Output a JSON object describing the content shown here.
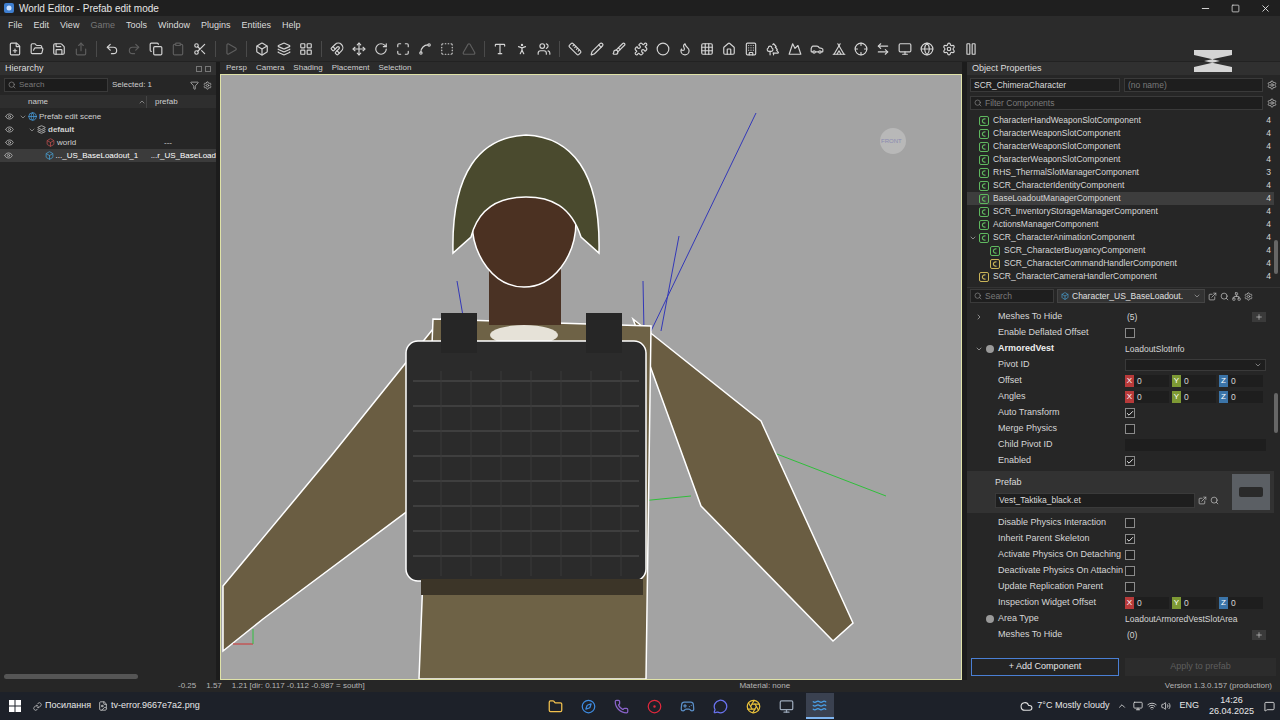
{
  "window": {
    "title": "World Editor - Prefab edit mode"
  },
  "menu": [
    {
      "label": "File",
      "disabled": false
    },
    {
      "label": "Edit",
      "disabled": false
    },
    {
      "label": "View",
      "disabled": false
    },
    {
      "label": "Game",
      "disabled": true
    },
    {
      "label": "Tools",
      "disabled": false
    },
    {
      "label": "Window",
      "disabled": false
    },
    {
      "label": "Plugins",
      "disabled": false
    },
    {
      "label": "Entities",
      "disabled": false
    },
    {
      "label": "Help",
      "disabled": false
    }
  ],
  "toolbar": [
    {
      "kind": "button",
      "disabled": false
    },
    {
      "kind": "button",
      "disabled": false
    },
    {
      "kind": "button",
      "disabled": false
    },
    {
      "kind": "button",
      "disabled": true
    },
    {
      "kind": "separator"
    },
    {
      "kind": "button",
      "disabled": false
    },
    {
      "kind": "button",
      "disabled": true
    },
    {
      "kind": "button",
      "disabled": false
    },
    {
      "kind": "button",
      "disabled": true
    },
    {
      "kind": "button",
      "disabled": false
    },
    {
      "kind": "separator"
    },
    {
      "kind": "button",
      "disabled": true
    },
    {
      "kind": "separator"
    },
    {
      "kind": "button",
      "disabled": false
    },
    {
      "kind": "button",
      "disabled": false
    },
    {
      "kind": "button",
      "disabled": false
    },
    {
      "kind": "separator"
    },
    {
      "kind": "button",
      "disabled": false
    },
    {
      "kind": "button",
      "disabled": false
    },
    {
      "kind": "button",
      "disabled": false
    },
    {
      "kind": "button",
      "disabled": false
    },
    {
      "kind": "button",
      "disabled": false
    },
    {
      "kind": "button",
      "disabled": false
    },
    {
      "kind": "button",
      "disabled": true
    },
    {
      "kind": "separator"
    },
    {
      "kind": "button",
      "disabled": false
    },
    {
      "kind": "button",
      "disabled": false
    },
    {
      "kind": "button",
      "disabled": false
    },
    {
      "kind": "separator"
    },
    {
      "kind": "button",
      "disabled": false
    },
    {
      "kind": "button",
      "disabled": false
    },
    {
      "kind": "button",
      "disabled": false
    },
    {
      "kind": "button",
      "disabled": false
    },
    {
      "kind": "button",
      "disabled": false
    },
    {
      "kind": "button",
      "disabled": false
    },
    {
      "kind": "button",
      "disabled": false
    },
    {
      "kind": "button",
      "disabled": false
    },
    {
      "kind": "button",
      "disabled": false
    },
    {
      "kind": "button",
      "disabled": false
    },
    {
      "kind": "button",
      "disabled": false
    },
    {
      "kind": "button",
      "disabled": false
    },
    {
      "kind": "button",
      "disabled": false
    },
    {
      "kind": "button",
      "disabled": false
    },
    {
      "kind": "button",
      "disabled": false
    },
    {
      "kind": "button",
      "disabled": false
    },
    {
      "kind": "button",
      "disabled": false
    },
    {
      "kind": "button",
      "disabled": false
    },
    {
      "kind": "button",
      "disabled": false
    }
  ],
  "hierarchy": {
    "title": "Hierarchy",
    "search_placeholder": "Search",
    "selected_count": "Selected: 1",
    "columns": [
      "name",
      "prefab"
    ],
    "tree": [
      {
        "name": "Prefab edit scene",
        "prefab": "",
        "kind": "scene",
        "visible": true,
        "selected": false,
        "expanded": true,
        "children": [
          {
            "name": "default",
            "prefab": "",
            "kind": "layer",
            "visible": true,
            "selected": false,
            "expanded": true,
            "children": [
              {
                "name": "world",
                "prefab": "---",
                "kind": "world",
                "visible": true,
                "selected": false
              },
              {
                "name": "..._US_BaseLoadout_1",
                "prefab": "...r_US_BaseLoad",
                "kind": "entity",
                "visible": true,
                "selected": true
              }
            ]
          }
        ]
      }
    ]
  },
  "viewport": {
    "tabs": [
      "Persp",
      "Camera",
      "Shading",
      "Placement",
      "Selection"
    ],
    "gizmo_label": "FRONT"
  },
  "properties": {
    "title": "Object Properties",
    "class_name": "SCR_ChimeraCharacter",
    "entity_name": "(no name)",
    "filter_placeholder": "Filter Components",
    "components": [
      {
        "name": "CharacterHandWeaponSlotComponent",
        "count": "4",
        "selected": false,
        "color": "#5fb85f"
      },
      {
        "name": "CharacterWeaponSlotComponent",
        "count": "4",
        "selected": false,
        "color": "#5fb85f"
      },
      {
        "name": "CharacterWeaponSlotComponent",
        "count": "4",
        "selected": false,
        "color": "#5fb85f"
      },
      {
        "name": "CharacterWeaponSlotComponent",
        "count": "4",
        "selected": false,
        "color": "#5fb85f"
      },
      {
        "name": "RHS_ThermalSlotManagerComponent",
        "count": "3",
        "selected": false,
        "color": "#5fb85f"
      },
      {
        "name": "SCR_CharacterIdentityComponent",
        "count": "4",
        "selected": false,
        "color": "#5fb85f"
      },
      {
        "name": "BaseLoadoutManagerComponent",
        "count": "4",
        "selected": true,
        "color": "#5fb85f"
      },
      {
        "name": "SCR_InventoryStorageManagerComponent",
        "count": "4",
        "selected": false,
        "color": "#5fb85f"
      },
      {
        "name": "ActionsManagerComponent",
        "count": "4",
        "selected": false,
        "color": "#5fb85f"
      },
      {
        "name": "SCR_CharacterAnimationComponent",
        "count": "4",
        "selected": false,
        "color": "#5fb85f",
        "expanded": true,
        "children": [
          {
            "name": "SCR_CharacterBuoyancyComponent",
            "count": "4",
            "selected": false,
            "color": "#5fb85f"
          },
          {
            "name": "SCR_CharacterCommandHandlerComponent",
            "count": "4",
            "selected": false,
            "color": "#c9b458"
          }
        ]
      },
      {
        "name": "SCR_CharacterCameraHandlerComponent",
        "count": "4",
        "selected": false,
        "color": "#c9b458"
      }
    ],
    "search_placeholder": "Search",
    "prefab_name": "Character_US_BaseLoadout.",
    "fields": [
      {
        "kind": "list",
        "label": "Meshes To Hide",
        "value": "(5)",
        "expanded": false
      },
      {
        "kind": "check",
        "label": "Enable Deflated Offset",
        "checked": false
      },
      {
        "kind": "group",
        "label": "ArmoredVest",
        "value": "LoadoutSlotInfo",
        "expanded": true,
        "dot": true
      },
      {
        "kind": "dropdown",
        "label": "Pivot ID",
        "value": ""
      },
      {
        "kind": "vec3",
        "label": "Offset",
        "axes": [
          {
            "axis": "X",
            "value": "0",
            "color": "#b83a3a"
          },
          {
            "axis": "Y",
            "value": "0",
            "color": "#7e9a34"
          },
          {
            "axis": "Z",
            "value": "0",
            "color": "#3b74a8"
          }
        ]
      },
      {
        "kind": "vec3",
        "label": "Angles",
        "axes": [
          {
            "axis": "X",
            "value": "0",
            "color": "#b83a3a"
          },
          {
            "axis": "Y",
            "value": "0",
            "color": "#7e9a34"
          },
          {
            "axis": "Z",
            "value": "0",
            "color": "#3b74a8"
          }
        ]
      },
      {
        "kind": "check",
        "label": "Auto Transform",
        "checked": true
      },
      {
        "kind": "check",
        "label": "Merge Physics",
        "checked": false
      },
      {
        "kind": "text",
        "label": "Child Pivot ID",
        "value": ""
      },
      {
        "kind": "check",
        "label": "Enabled",
        "checked": true
      },
      {
        "kind": "prefab",
        "label": "Prefab",
        "value": "Vest_Taktika_black.et"
      },
      {
        "kind": "check",
        "label": "Disable Physics Interaction",
        "checked": false
      },
      {
        "kind": "check",
        "label": "Inherit Parent Skeleton",
        "checked": true
      },
      {
        "kind": "check",
        "label": "Activate Physics On Detaching",
        "checked": false
      },
      {
        "kind": "check",
        "label": "Deactivate Physics On Attachin",
        "checked": false
      },
      {
        "kind": "check",
        "label": "Update Replication Parent",
        "checked": false
      },
      {
        "kind": "vec3",
        "label": "Inspection Widget Offset",
        "axes": [
          {
            "axis": "X",
            "value": "0",
            "color": "#b83a3a"
          },
          {
            "axis": "Y",
            "value": "0",
            "color": "#7e9a34"
          },
          {
            "axis": "Z",
            "value": "0",
            "color": "#3b74a8"
          }
        ]
      },
      {
        "kind": "enum",
        "label": "Area Type",
        "value": "LoadoutArmoredVestSlotArea",
        "dot": true
      },
      {
        "kind": "list",
        "label": "Meshes To Hide",
        "value": "(0)"
      }
    ],
    "add_button": "+ Add Component",
    "apply_button": {
      "label": "Apply to prefab",
      "disabled": true
    }
  },
  "status_bar": {
    "coords": [
      "-0.25",
      "1.57",
      "1.21 [dir: 0.117 -0.112 -0.987 = south]"
    ],
    "material": "Material: none",
    "version": "Version 1.3.0.157 (production)"
  },
  "taskbar": {
    "links": "Посилання",
    "file": "tv-error.9667e7a2.png",
    "apps": [
      {
        "color": "#f2c14e",
        "selected": false
      },
      {
        "color": "#3d8be0",
        "selected": false
      },
      {
        "color": "#8a63c9",
        "selected": false
      },
      {
        "color": "#e0283c",
        "selected": false
      },
      {
        "color": "#5b8fc7",
        "selected": false
      },
      {
        "color": "#6b74f2",
        "selected": false
      },
      {
        "color": "#e8c03a",
        "selected": false
      },
      {
        "color": "#9aa7b8",
        "selected": false
      },
      {
        "color": "#4aa0e8",
        "selected": true
      }
    ],
    "weather": "7°C Mostly cloudy",
    "language": "ENG",
    "time": "14:26",
    "date": "26.04.2025"
  }
}
